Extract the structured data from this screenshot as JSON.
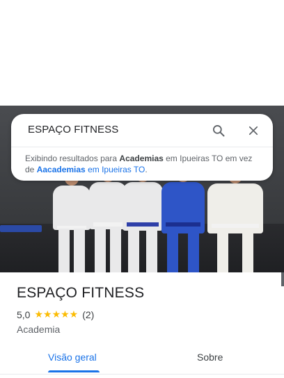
{
  "search": {
    "query": "ESPAÇO FITNESS",
    "suggestion_part1": "Exibindo resultados para ",
    "suggestion_bold1": "Academias",
    "suggestion_part2": " em Ipueiras TO em vez de ",
    "suggestion_link_bold": "Aacademias",
    "suggestion_link_rest": " em Ipueiras TO",
    "suggestion_end": "."
  },
  "place": {
    "name": "ESPAÇO FITNESS",
    "rating": "5,0",
    "stars": "★★★★★",
    "review_count": "(2)",
    "category": "Academia"
  },
  "tabs": [
    "Visão geral",
    "Sobre"
  ],
  "icons": {
    "search": "search-icon",
    "close": "close-icon"
  },
  "colors": {
    "accent": "#1a73e8",
    "star": "#fbbc04"
  }
}
